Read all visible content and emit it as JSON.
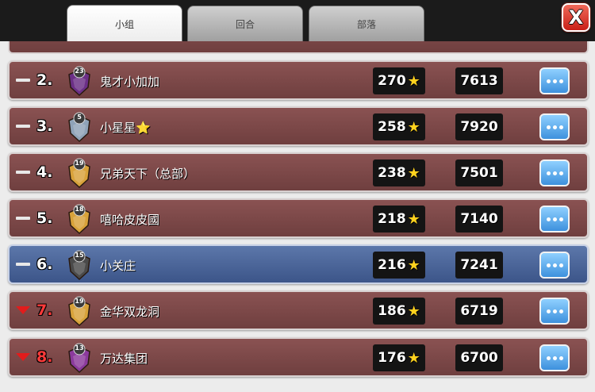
{
  "tabs": [
    {
      "label": "小组",
      "active": true
    },
    {
      "label": "回合",
      "active": false
    },
    {
      "label": "部落",
      "active": false
    }
  ],
  "close_label": "X",
  "colors": {
    "row": "#7d4848",
    "row_highlight": "#4a64a0",
    "rank_down": "#ff3a3a",
    "star": "#ffd21e",
    "more_button": "#5aaaf0"
  },
  "rows": [
    {
      "rank": "2.",
      "trend": "same",
      "badge_level": "23",
      "badge_color": "#6b2f86",
      "name": "鬼才小加加",
      "name_star": "",
      "stars": "270",
      "trophies": "7613",
      "highlight": false
    },
    {
      "rank": "3.",
      "trend": "same",
      "badge_level": "5",
      "badge_color": "#8fa3b8",
      "name": "小星星",
      "name_star": "⭐",
      "stars": "258",
      "trophies": "7920",
      "highlight": false
    },
    {
      "rank": "4.",
      "trend": "same",
      "badge_level": "19",
      "badge_color": "#d8a23a",
      "name": "兄弟天下（总部）",
      "name_star": "",
      "stars": "238",
      "trophies": "7501",
      "highlight": false
    },
    {
      "rank": "5.",
      "trend": "same",
      "badge_level": "18",
      "badge_color": "#d8a23a",
      "name": "嘻哈皮皮國",
      "name_star": "",
      "stars": "218",
      "trophies": "7140",
      "highlight": false
    },
    {
      "rank": "6.",
      "trend": "same",
      "badge_level": "15",
      "badge_color": "#4a4a4a",
      "name": "小关庄",
      "name_star": "",
      "stars": "216",
      "trophies": "7241",
      "highlight": true
    },
    {
      "rank": "7.",
      "trend": "down",
      "badge_level": "19",
      "badge_color": "#d8a23a",
      "name": "金华双龙洞",
      "name_star": "",
      "stars": "186",
      "trophies": "6719",
      "highlight": false
    },
    {
      "rank": "8.",
      "trend": "down",
      "badge_level": "13",
      "badge_color": "#8b3a9c",
      "name": "万达集团",
      "name_star": "",
      "stars": "176",
      "trophies": "6700",
      "highlight": false
    }
  ]
}
